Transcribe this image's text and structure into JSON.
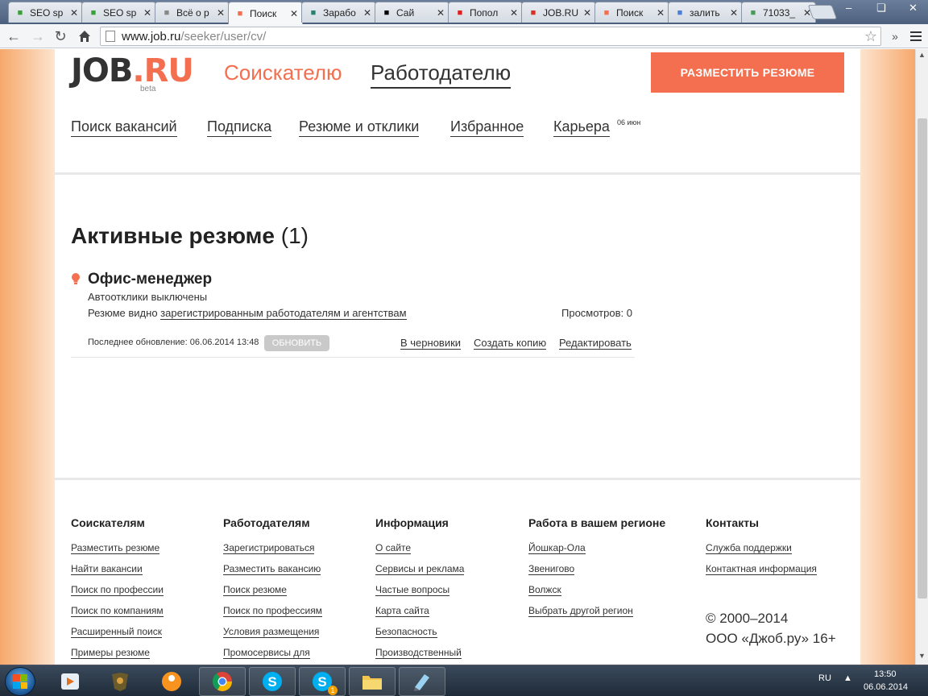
{
  "tabs": [
    {
      "label": "SEO sp",
      "favicon": "seo-sprint-icon",
      "color": "#3aa03a"
    },
    {
      "label": "SEO sp",
      "favicon": "seo-sprint-icon",
      "color": "#3aa03a"
    },
    {
      "label": "Всё о р",
      "favicon": "document-icon",
      "color": "#888888"
    },
    {
      "label": "Поиск",
      "favicon": "job-ru-icon",
      "color": "#f36f4f"
    },
    {
      "label": "Зарабо",
      "favicon": "money-icon",
      "color": "#2a7f6f"
    },
    {
      "label": "Сай",
      "favicon": "envelope-icon",
      "color": "#000000"
    },
    {
      "label": "Попол",
      "favicon": "youtube-icon",
      "color": "#e02020"
    },
    {
      "label": "JOB.RU",
      "favicon": "gmail-icon",
      "color": "#d93025"
    },
    {
      "label": "Поиск",
      "favicon": "job-ru-icon",
      "color": "#f36f4f"
    },
    {
      "label": "залить",
      "favicon": "google-icon",
      "color": "#4a7fd8"
    },
    {
      "label": "71033_",
      "favicon": "image-icon",
      "color": "#4a9a5a"
    }
  ],
  "toolbar": {
    "url_host": "www.job.ru",
    "url_path": "/seeker/user/cv/"
  },
  "header": {
    "logo_job": "JOB",
    "logo_ru": ".RU",
    "logo_beta": "beta",
    "role_seeker": "Соискателю",
    "role_employer": "Работодателю",
    "cta": "РАЗМЕСТИТЬ РЕЗЮМЕ"
  },
  "subnav": {
    "items": [
      "Поиск вакансий",
      "Подписка",
      "Резюме и отклики",
      "Избранное",
      "Карьера"
    ],
    "career_sup": "06 июн"
  },
  "section": {
    "title": "Активные резюме",
    "count": "(1)"
  },
  "resume": {
    "title": "Офис-менеджер",
    "autoreply": "Автоотклики выключены",
    "visibility_prefix": "Резюме видно ",
    "visibility_link": "зарегистрированным работодателям и агентствам",
    "views": "Просмотров: 0",
    "updated": "Последнее обновление: 06.06.2014 13:48",
    "refresh": "ОБНОВИТЬ",
    "actions": [
      "В черновики",
      "Создать копию",
      "Редактировать"
    ]
  },
  "footer": {
    "columns": [
      {
        "title": "Соискателям",
        "links": [
          "Разместить резюме",
          "Найти вакансии",
          "Поиск по профессии",
          "Поиск по компаниям",
          "Расширенный поиск",
          "Примеры резюме"
        ]
      },
      {
        "title": "Работодателям",
        "links": [
          "Зарегистрироваться",
          "Разместить вакансию",
          "Поиск резюме",
          "Поиск по профессиям",
          "Условия размещения",
          "Промосервисы для"
        ]
      },
      {
        "title": "Информация",
        "links": [
          "О сайте",
          "Сервисы и реклама",
          "Частые вопросы",
          "Карта сайта",
          "Безопасность",
          "Производственный"
        ]
      },
      {
        "title": "Работа в вашем регионе",
        "links": [
          "Йошкар-Ола",
          "Звенигово",
          "Волжск",
          "Выбрать другой регион"
        ]
      },
      {
        "title": "Контакты",
        "links": [
          "Служба поддержки",
          "Контактная информация"
        ]
      }
    ],
    "copyright_years": "© 2000–2014",
    "copyright_company": "ООО «Джоб.ру» 16+"
  },
  "taskbar": {
    "lang": "RU",
    "time": "13:50",
    "date": "06.06.2014",
    "skype_badge": "1"
  },
  "colors": {
    "brand": "#f36f4f",
    "text": "#333333"
  }
}
